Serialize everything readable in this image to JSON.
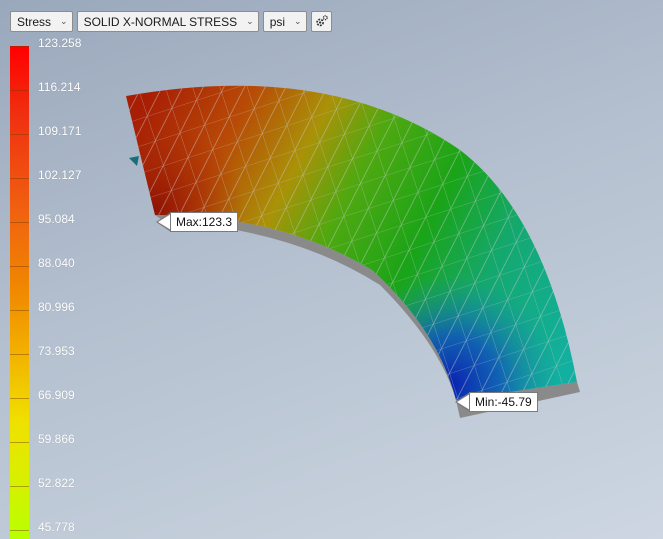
{
  "toolbar": {
    "result_type": "Stress",
    "component": "SOLID X-NORMAL STRESS",
    "unit": "psi",
    "settings_icon": "gear-icon"
  },
  "legend": {
    "values": [
      "123.258",
      "116.214",
      "109.171",
      "102.127",
      "95.084",
      "88.040",
      "80.996",
      "73.953",
      "66.909",
      "59.866",
      "52.822",
      "45.778"
    ]
  },
  "probes": {
    "max_label": "Max:123.3",
    "min_label": "Min:-45.79"
  }
}
